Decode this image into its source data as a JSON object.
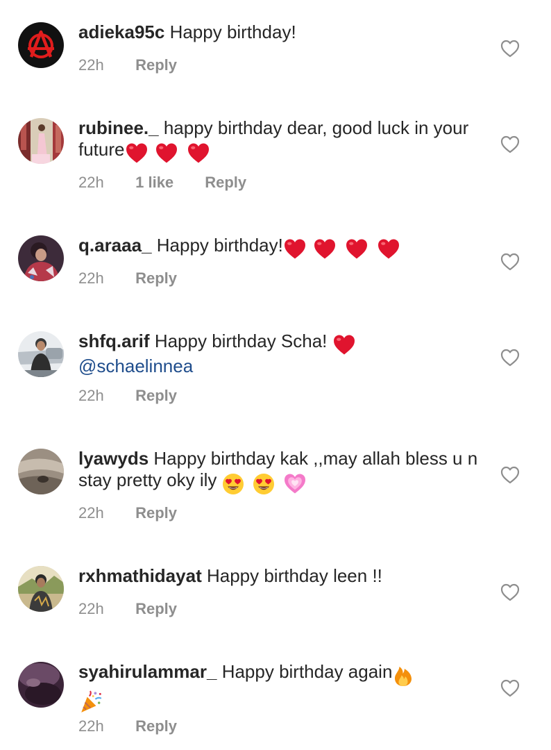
{
  "comments": [
    {
      "username": "adieka95c",
      "text": "Happy birthday!",
      "emojis": [],
      "time": "22h",
      "likes": "",
      "reply": "Reply",
      "avatar": "anarchy-symbol-avatar"
    },
    {
      "username": "rubinee._",
      "text": "happy birthday dear, good luck in your future",
      "emojis": [
        "red-heart",
        "red-heart",
        "red-heart"
      ],
      "time": "22h",
      "likes": "1 like",
      "reply": "Reply",
      "avatar": "woman-in-pink-dress-avatar"
    },
    {
      "username": "q.araaa_",
      "text": "Happy birthday!",
      "emojis": [
        "red-heart",
        "red-heart",
        "red-heart",
        "red-heart"
      ],
      "time": "22h",
      "likes": "",
      "reply": "Reply",
      "avatar": "person-photo-avatar"
    },
    {
      "username": "shfq.arif",
      "text": "Happy birthday Scha!",
      "emojis": [
        "red-heart"
      ],
      "mention": "@schaelinnea",
      "time": "22h",
      "likes": "",
      "reply": "Reply",
      "avatar": "man-with-car-avatar"
    },
    {
      "username": "lyawyds",
      "text": "Happy birthday kak ,,may allah bless u n stay pretty oky ily",
      "emojis": [
        "heart-eyes-face",
        "heart-eyes-face",
        "growing-heart"
      ],
      "time": "22h",
      "likes": "",
      "reply": "Reply",
      "avatar": "blurry-photo-avatar"
    },
    {
      "username": "rxhmathidayat",
      "text": "Happy birthday leen !!",
      "emojis": [],
      "time": "22h",
      "likes": "",
      "reply": "Reply",
      "avatar": "man-outdoors-avatar"
    },
    {
      "username": "syahirulammar_",
      "text": "Happy birthday again",
      "emojis": [
        "fire",
        "party-popper"
      ],
      "time": "22h",
      "likes": "",
      "reply": "Reply",
      "avatar": "dark-purple-photo-avatar"
    }
  ],
  "colors": {
    "text": "#262626",
    "muted": "#8e8e8e",
    "mention": "#1f4d8c",
    "heart_emoji": "#e0142e",
    "like_icon": "#8e8e8e"
  },
  "icons": {
    "like": "heart-outline-icon"
  }
}
